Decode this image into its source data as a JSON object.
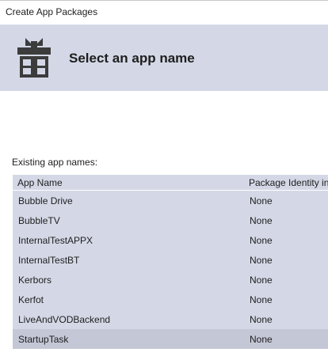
{
  "window": {
    "title": "Create App Packages"
  },
  "header": {
    "heading": "Select an app name",
    "icon": "gift-icon"
  },
  "existing": {
    "label": "Existing app names:"
  },
  "table": {
    "columns": [
      "App Name",
      "Package Identity in"
    ],
    "rows": [
      {
        "name": "Bubble Drive",
        "identity": "None"
      },
      {
        "name": "BubbleTV",
        "identity": "None"
      },
      {
        "name": "InternalTestAPPX",
        "identity": "None"
      },
      {
        "name": "InternalTestBT",
        "identity": "None"
      },
      {
        "name": "Kerbors",
        "identity": "None"
      },
      {
        "name": "Kerfot",
        "identity": "None"
      },
      {
        "name": "LiveAndVODBackend",
        "identity": "None"
      },
      {
        "name": "StartupTask",
        "identity": "None"
      }
    ],
    "selected_index": 7
  },
  "colors": {
    "band": "#d4d8e6",
    "selected_row": "#c4c7d6",
    "icon": "#3c3c3c"
  }
}
